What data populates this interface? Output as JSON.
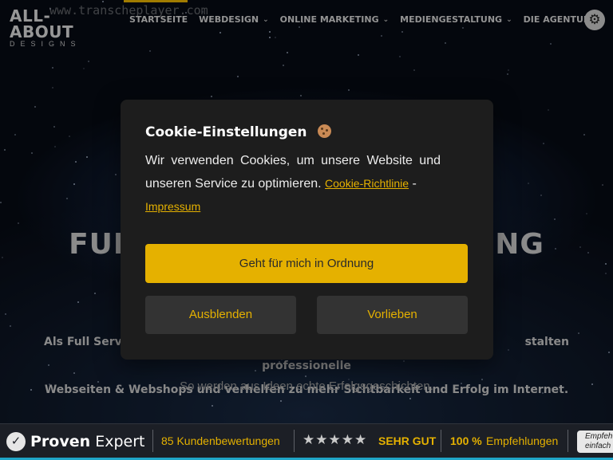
{
  "header": {
    "ghost_url": "www.transcheplayer.com",
    "logo_line1": "ALL-ABOUT",
    "logo_line2": "DESIGNS",
    "nav": [
      {
        "label": "STARTSEITE",
        "has_dropdown": false
      },
      {
        "label": "WEBDESIGN",
        "has_dropdown": true
      },
      {
        "label": "ONLINE MARKETING",
        "has_dropdown": true
      },
      {
        "label": "MEDIENGESTALTUNG",
        "has_dropdown": true
      },
      {
        "label": "DIE AGENTUR",
        "has_dropdown": true
      }
    ],
    "settings_icon": "gear-icon",
    "accent_color": "#e5b100"
  },
  "hero": {
    "title_left": "FUL",
    "title_right": "ING",
    "text_line1_left": "Als Full Service Werb",
    "text_line1_right": "stalten professionelle",
    "text_line2": "Webseiten & Webshops und verhelfen zu mehr Sichtbarkeit und Erfolg im Internet.",
    "subtitle": "So werden aus Ideen echte Erfolgsgeschichten."
  },
  "cookie_modal": {
    "title": "Cookie-Einstellungen",
    "title_icon": "cookie-icon",
    "text": "Wir verwenden Cookies, um unsere Website und unseren Service zu optimieren.",
    "policy_link": "Cookie-Richtlinie",
    "separator": "-",
    "imprint_link": "Impressum",
    "accept_button": "Geht für mich in Ordnung",
    "hide_button": "Ausblenden",
    "preferences_button": "Vorlieben",
    "button_color": "#e5b100"
  },
  "proven_expert": {
    "brand_bold": "Proven",
    "brand_light": "Expert",
    "reviews": "85 Kundenbewertungen",
    "stars": "★★★★★",
    "star_rating": 5,
    "rating_label": "SEHR GUT",
    "recommend_pct": "100 %",
    "recommend_label": "Empfehlungen",
    "badge_line1": "Empfeh",
    "badge_line2": "einfach",
    "bar_accent": "#1fa5c8"
  }
}
